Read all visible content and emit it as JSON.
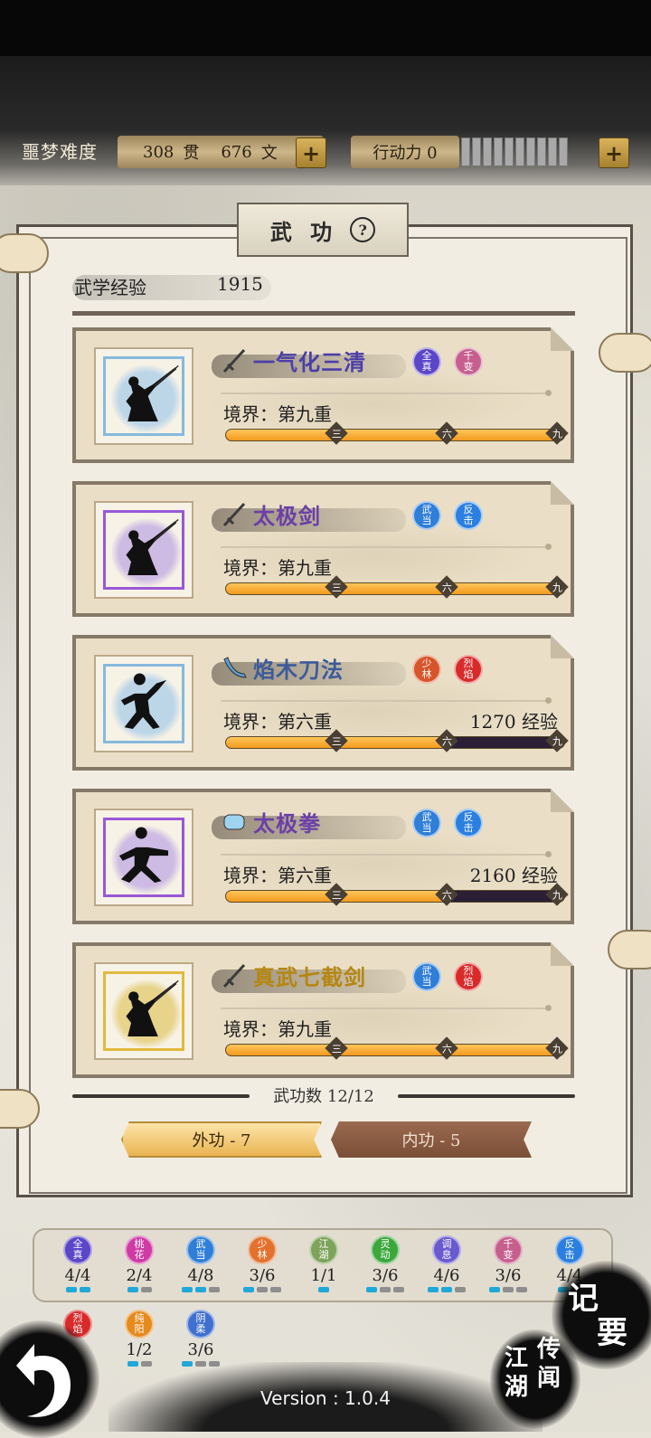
{
  "header": {
    "difficulty": "噩梦难度",
    "money": {
      "guan": "308",
      "guan_unit": "贯",
      "wen": "676",
      "wen_unit": "文"
    },
    "stamina_label": "行动力 0",
    "stamina_segments": 10,
    "stamina_filled": 0
  },
  "panel": {
    "title": "武 功",
    "help": "?",
    "exp_label": "武学经验",
    "exp_value": "1915"
  },
  "skills": [
    {
      "name": "一气化三清",
      "name_color": "#4b3ea8",
      "weapon": "sword",
      "badges": [
        {
          "t": "全\n真",
          "c": "#5b45c9"
        },
        {
          "t": "千\n变",
          "c": "#c75f8e"
        }
      ],
      "realm": "境界：第九重",
      "exp": "",
      "progress": 1.0,
      "frame": "#86b9de",
      "glow": "#bcd6e8",
      "pose": "sword"
    },
    {
      "name": "太极剑",
      "name_color": "#6b3fa8",
      "weapon": "sword",
      "badges": [
        {
          "t": "武\n当",
          "c": "#2f7ed8"
        },
        {
          "t": "反\n击",
          "c": "#2a7fe0"
        }
      ],
      "realm": "境界：第九重",
      "exp": "",
      "progress": 1.0,
      "frame": "#9a57d6",
      "glow": "#cdbbe3",
      "pose": "sword"
    },
    {
      "name": "焰木刀法",
      "name_color": "#3b5b9a",
      "weapon": "blade",
      "badges": [
        {
          "t": "少\n林",
          "c": "#d8542a"
        },
        {
          "t": "烈\n焰",
          "c": "#d92a2a"
        }
      ],
      "realm": "境界：第六重",
      "exp": "1270 经验",
      "progress": 0.66,
      "frame": "#86b9de",
      "glow": "#bcd6e8",
      "pose": "blade"
    },
    {
      "name": "太极拳",
      "name_color": "#6b3fa8",
      "weapon": "fist",
      "badges": [
        {
          "t": "武\n当",
          "c": "#2f7ed8"
        },
        {
          "t": "反\n击",
          "c": "#2a7fe0"
        }
      ],
      "realm": "境界：第六重",
      "exp": "2160 经验",
      "progress": 0.66,
      "frame": "#9a57d6",
      "glow": "#cdbbe3",
      "pose": "fist"
    },
    {
      "name": "真武七截剑",
      "name_color": "#b58612",
      "weapon": "sword",
      "badges": [
        {
          "t": "武\n当",
          "c": "#2f7ed8"
        },
        {
          "t": "烈\n焰",
          "c": "#d92a2a"
        }
      ],
      "realm": "境界：第九重",
      "exp": "",
      "progress": 1.0,
      "frame": "#e2b93c",
      "glow": "#e7d389",
      "pose": "sword"
    }
  ],
  "ticks": [
    "三",
    "六",
    "九"
  ],
  "count_text": "武功数 12/12",
  "tabs": {
    "external": "外功 - 7",
    "internal": "内功 - 5"
  },
  "schools": [
    {
      "t": "全\n真",
      "c": "#5b45c9",
      "count": "4/4",
      "pips": [
        1,
        1
      ]
    },
    {
      "t": "桃\n花",
      "c": "#cf3aa5",
      "count": "2/4",
      "pips": [
        1,
        0
      ]
    },
    {
      "t": "武\n当",
      "c": "#2f7ed8",
      "count": "4/8",
      "pips": [
        1,
        1,
        0
      ]
    },
    {
      "t": "少\n林",
      "c": "#e3702d",
      "count": "3/6",
      "pips": [
        1,
        0,
        0
      ]
    },
    {
      "t": "江\n湖",
      "c": "#7ea35a",
      "count": "1/1",
      "pips": [
        1
      ]
    },
    {
      "t": "灵\n动",
      "c": "#3ca83c",
      "count": "3/6",
      "pips": [
        1,
        0,
        0
      ]
    },
    {
      "t": "调\n息",
      "c": "#6a5ad0",
      "count": "4/6",
      "pips": [
        1,
        1,
        0
      ]
    },
    {
      "t": "千\n变",
      "c": "#c75f8e",
      "count": "3/6",
      "pips": [
        1,
        0,
        0
      ]
    },
    {
      "t": "反\n击",
      "c": "#2a7fe0",
      "count": "4/4",
      "pips": [
        1,
        1
      ]
    },
    {
      "t": "烈\n焰",
      "c": "#d92a2a",
      "count": "",
      "pips": []
    },
    {
      "t": "纯\n阳",
      "c": "#e68a1e",
      "count": "1/2",
      "pips": [
        1,
        0
      ]
    },
    {
      "t": "阴\n柔",
      "c": "#3f6fd0",
      "count": "3/6",
      "pips": [
        1,
        0,
        0
      ]
    }
  ],
  "corner": {
    "memo": [
      "记",
      "要"
    ],
    "legend": [
      "江",
      "传",
      "湖",
      "闻"
    ]
  },
  "version": "Version : 1.0.4"
}
